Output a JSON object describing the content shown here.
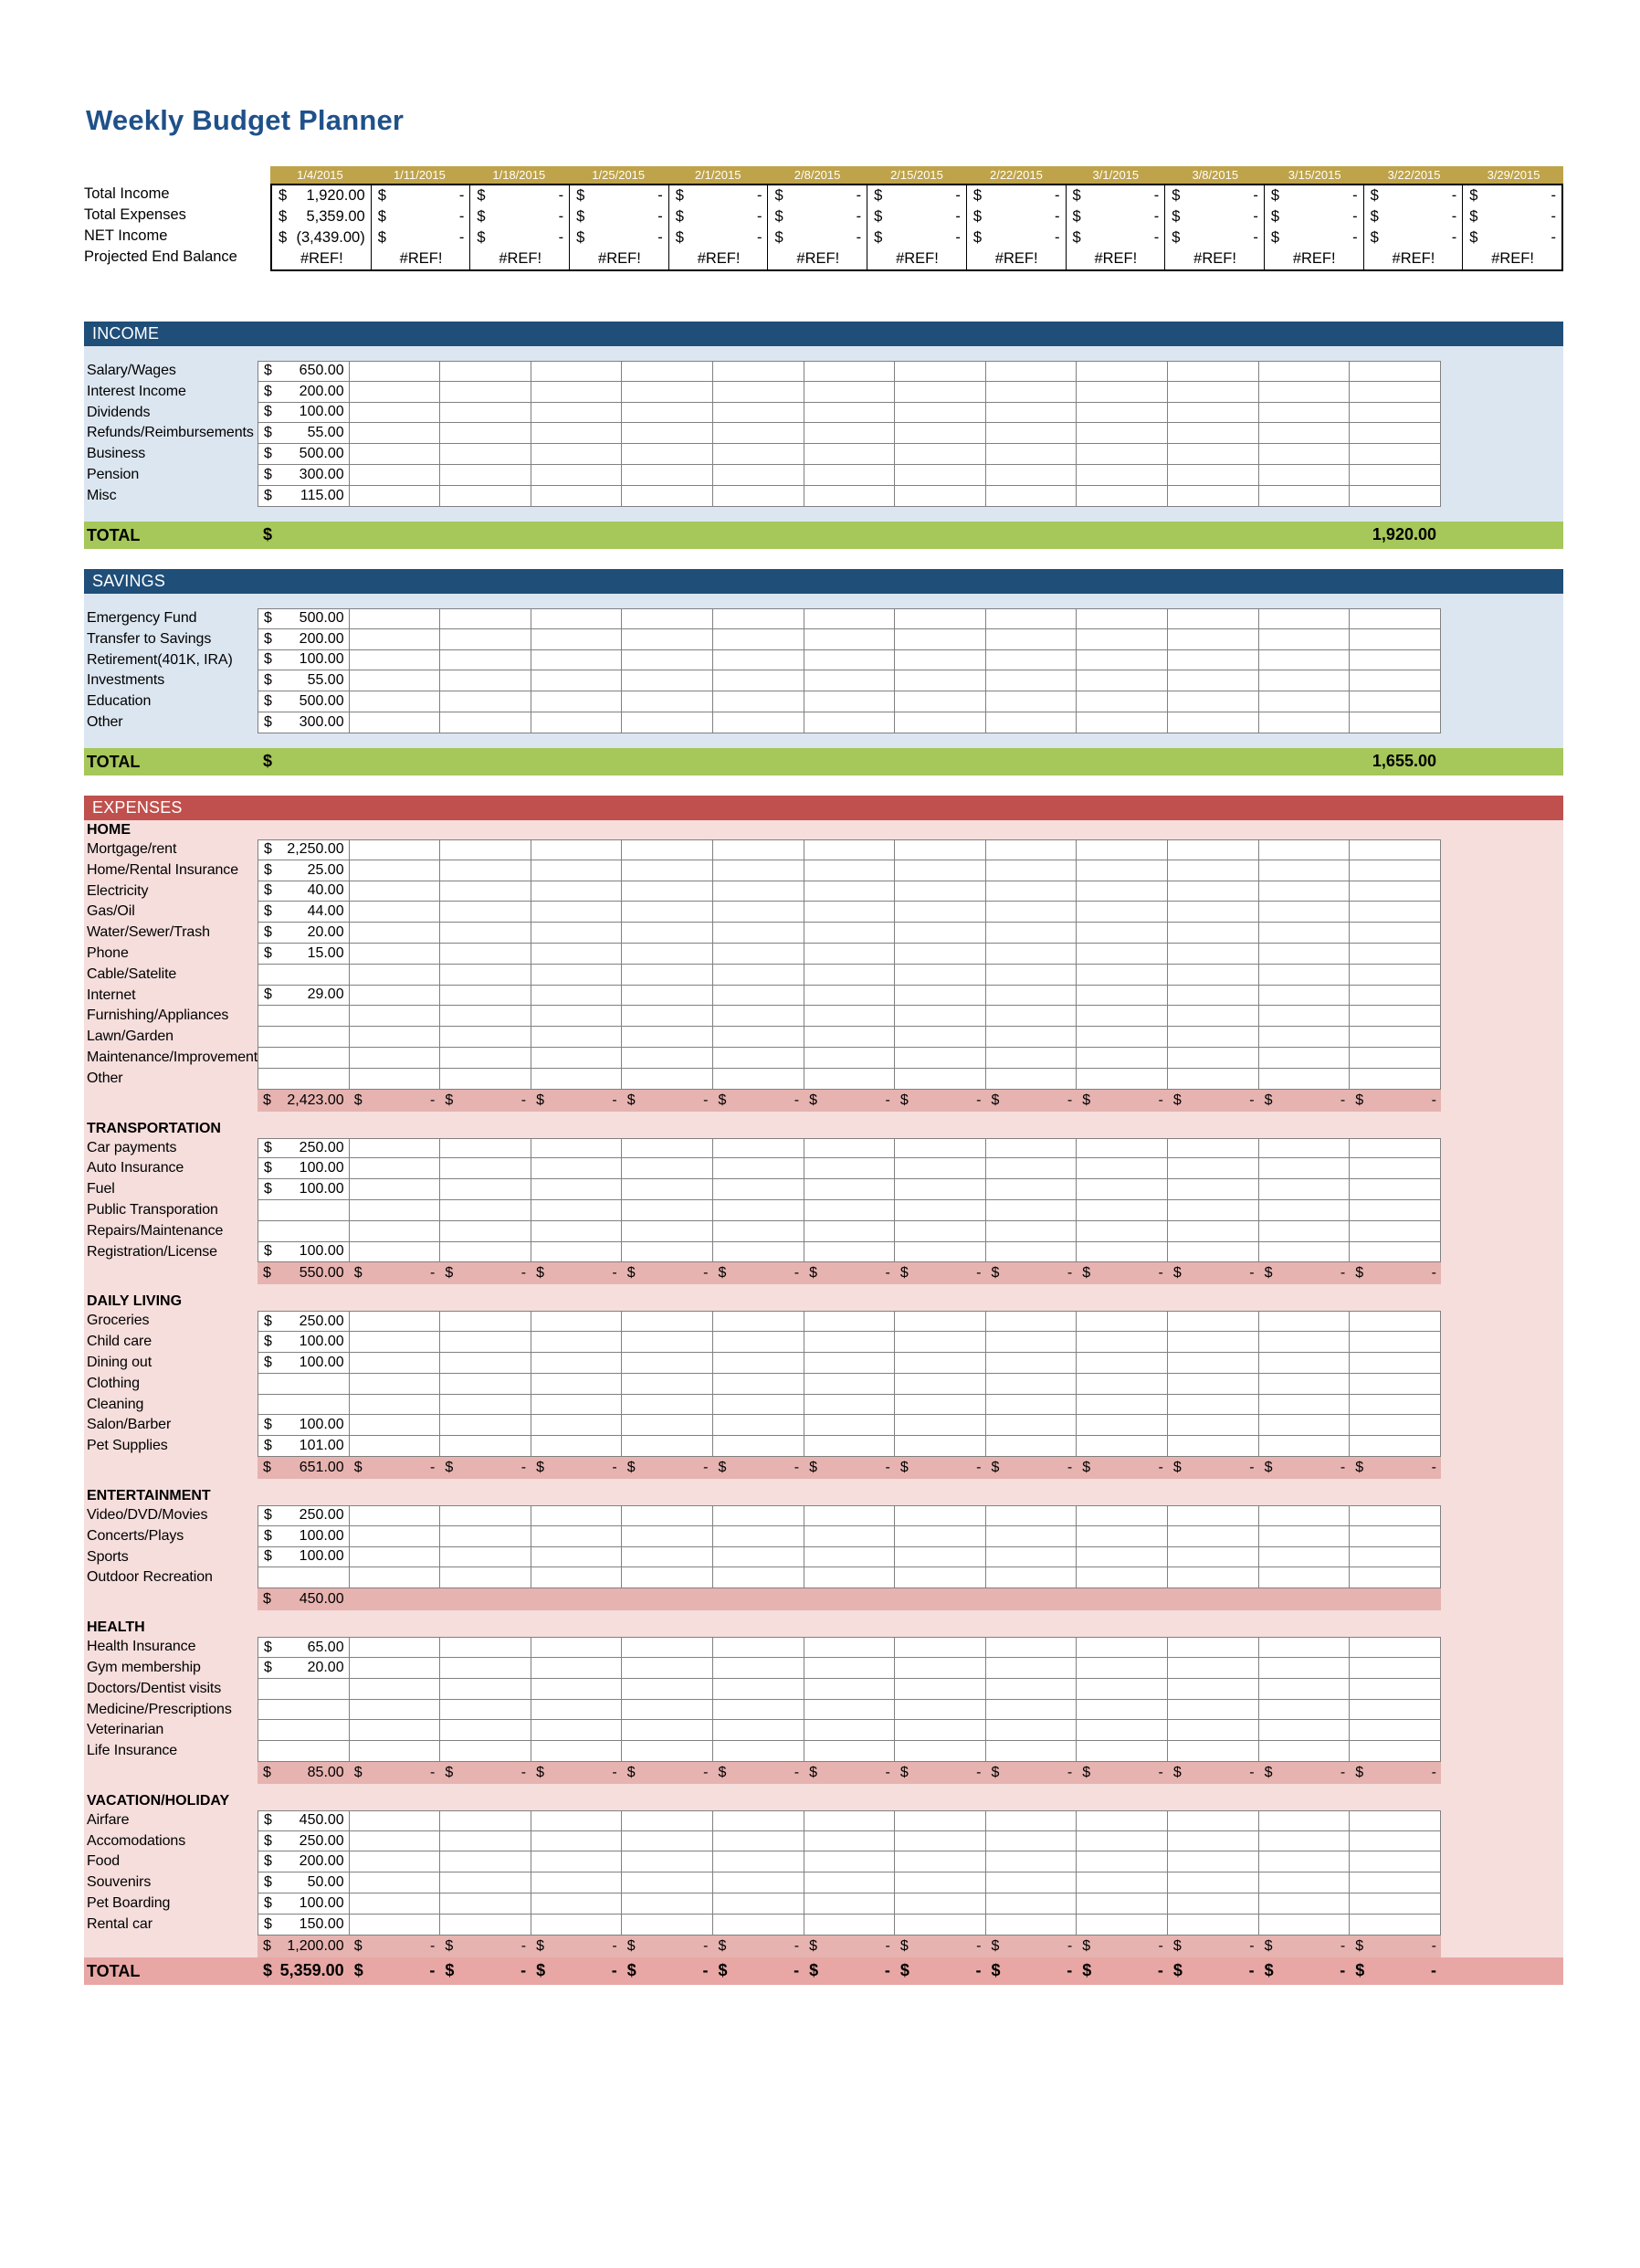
{
  "title": "Weekly Budget Planner",
  "colors": {
    "title": "#1F5189",
    "date_header": "#BFA34A",
    "section_blue": "#1F4E79",
    "section_blue_body": "#DCE6F1",
    "section_red": "#C0504D",
    "section_red_body": "#F5DEDC",
    "total_green": "#A6C75A",
    "total_pink": "#E8A7A4",
    "subtotal_pink": "#E6B3B0"
  },
  "dates": [
    "1/4/2015",
    "1/11/2015",
    "1/18/2015",
    "1/25/2015",
    "2/1/2015",
    "2/8/2015",
    "2/15/2015",
    "2/22/2015",
    "3/1/2015",
    "3/8/2015",
    "3/15/2015",
    "3/22/2015",
    "3/29/2015"
  ],
  "summary": {
    "rows": [
      {
        "label": "Total Income",
        "values": [
          "1,920.00",
          "-",
          "-",
          "-",
          "-",
          "-",
          "-",
          "-",
          "-",
          "-",
          "-",
          "-",
          "-"
        ],
        "currency": "$"
      },
      {
        "label": "Total Expenses",
        "values": [
          "5,359.00",
          "-",
          "-",
          "-",
          "-",
          "-",
          "-",
          "-",
          "-",
          "-",
          "-",
          "-",
          "-"
        ],
        "currency": "$"
      },
      {
        "label": "NET Income",
        "values": [
          "(3,439.00)",
          "-",
          "-",
          "-",
          "-",
          "-",
          "-",
          "-",
          "-",
          "-",
          "-",
          "-",
          "-"
        ],
        "currency": "$"
      }
    ],
    "ref_row": {
      "label": "Projected End Balance",
      "values": [
        "#REF!",
        "#REF!",
        "#REF!",
        "#REF!",
        "#REF!",
        "#REF!",
        "#REF!",
        "#REF!",
        "#REF!",
        "#REF!",
        "#REF!",
        "#REF!",
        "#REF!"
      ]
    }
  },
  "income": {
    "header": "INCOME",
    "items": [
      {
        "label": "Salary/Wages",
        "value": "650.00",
        "currency": "$"
      },
      {
        "label": "Interest Income",
        "value": "200.00",
        "currency": "$"
      },
      {
        "label": "Dividends",
        "value": "100.00",
        "currency": "$"
      },
      {
        "label": "Refunds/Reimbursements",
        "value": "55.00",
        "currency": "$"
      },
      {
        "label": "Business",
        "value": "500.00",
        "currency": "$"
      },
      {
        "label": "Pension",
        "value": "300.00",
        "currency": "$"
      },
      {
        "label": "Misc",
        "value": "115.00",
        "currency": "$"
      }
    ],
    "total": {
      "label": "TOTAL",
      "currency": "$",
      "value": "1,920.00"
    }
  },
  "savings": {
    "header": "SAVINGS",
    "items": [
      {
        "label": "Emergency Fund",
        "value": "500.00",
        "currency": "$"
      },
      {
        "label": "Transfer to Savings",
        "value": "200.00",
        "currency": "$"
      },
      {
        "label": "Retirement(401K, IRA)",
        "value": "100.00",
        "currency": "$"
      },
      {
        "label": "Investments",
        "value": "55.00",
        "currency": "$"
      },
      {
        "label": "Education",
        "value": "500.00",
        "currency": "$"
      },
      {
        "label": "Other",
        "value": "300.00",
        "currency": "$"
      }
    ],
    "total": {
      "label": "TOTAL",
      "currency": "$",
      "value": "1,655.00"
    }
  },
  "expenses": {
    "header": "EXPENSES",
    "groups": [
      {
        "title": "HOME",
        "items": [
          {
            "label": "Mortgage/rent",
            "value": "2,250.00",
            "currency": "$"
          },
          {
            "label": "Home/Rental Insurance",
            "value": "25.00",
            "currency": "$"
          },
          {
            "label": "Electricity",
            "value": "40.00",
            "currency": "$"
          },
          {
            "label": "Gas/Oil",
            "value": "44.00",
            "currency": "$"
          },
          {
            "label": "Water/Sewer/Trash",
            "value": "20.00",
            "currency": "$"
          },
          {
            "label": "Phone",
            "value": "15.00",
            "currency": "$"
          },
          {
            "label": "Cable/Satelite",
            "value": "",
            "currency": ""
          },
          {
            "label": "Internet",
            "value": "29.00",
            "currency": "$"
          },
          {
            "label": "Furnishing/Appliances",
            "value": "",
            "currency": ""
          },
          {
            "label": "Lawn/Garden",
            "value": "",
            "currency": ""
          },
          {
            "label": "Maintenance/Improvements",
            "value": "",
            "currency": ""
          },
          {
            "label": "Other",
            "value": "",
            "currency": ""
          }
        ],
        "subtotal": {
          "currency": "$",
          "value": "2,423.00",
          "dash_count": 12
        }
      },
      {
        "title": "TRANSPORTATION",
        "items": [
          {
            "label": "Car payments",
            "value": "250.00",
            "currency": "$"
          },
          {
            "label": "Auto Insurance",
            "value": "100.00",
            "currency": "$"
          },
          {
            "label": "Fuel",
            "value": "100.00",
            "currency": "$"
          },
          {
            "label": "Public Transporation",
            "value": "",
            "currency": ""
          },
          {
            "label": "Repairs/Maintenance",
            "value": "",
            "currency": ""
          },
          {
            "label": "Registration/License",
            "value": "100.00",
            "currency": "$"
          }
        ],
        "subtotal": {
          "currency": "$",
          "value": "550.00",
          "dash_count": 12
        }
      },
      {
        "title": "DAILY LIVING",
        "items": [
          {
            "label": "Groceries",
            "value": "250.00",
            "currency": "$"
          },
          {
            "label": "Child care",
            "value": "100.00",
            "currency": "$"
          },
          {
            "label": "Dining out",
            "value": "100.00",
            "currency": "$"
          },
          {
            "label": "Clothing",
            "value": "",
            "currency": ""
          },
          {
            "label": "Cleaning",
            "value": "",
            "currency": ""
          },
          {
            "label": "Salon/Barber",
            "value": "100.00",
            "currency": "$"
          },
          {
            "label": "Pet Supplies",
            "value": "101.00",
            "currency": "$"
          }
        ],
        "subtotal": {
          "currency": "$",
          "value": "651.00",
          "dash_count": 12
        }
      },
      {
        "title": "ENTERTAINMENT",
        "items": [
          {
            "label": "Video/DVD/Movies",
            "value": "250.00",
            "currency": "$"
          },
          {
            "label": "Concerts/Plays",
            "value": "100.00",
            "currency": "$"
          },
          {
            "label": "Sports",
            "value": "100.00",
            "currency": "$"
          },
          {
            "label": "Outdoor Recreation",
            "value": "",
            "currency": ""
          }
        ],
        "subtotal": {
          "currency": "$",
          "value": "450.00",
          "dash_count": 0
        }
      },
      {
        "title": "HEALTH",
        "items": [
          {
            "label": "Health Insurance",
            "value": "65.00",
            "currency": "$"
          },
          {
            "label": "Gym membership",
            "value": "20.00",
            "currency": "$"
          },
          {
            "label": "Doctors/Dentist visits",
            "value": "",
            "currency": ""
          },
          {
            "label": "Medicine/Prescriptions",
            "value": "",
            "currency": ""
          },
          {
            "label": "Veterinarian",
            "value": "",
            "currency": ""
          },
          {
            "label": "Life Insurance",
            "value": "",
            "currency": ""
          }
        ],
        "subtotal": {
          "currency": "$",
          "value": "85.00",
          "dash_count": 12
        }
      },
      {
        "title": "VACATION/HOLIDAY",
        "items": [
          {
            "label": "Airfare",
            "value": "450.00",
            "currency": "$"
          },
          {
            "label": "Accomodations",
            "value": "250.00",
            "currency": "$"
          },
          {
            "label": "Food",
            "value": "200.00",
            "currency": "$"
          },
          {
            "label": "Souvenirs",
            "value": "50.00",
            "currency": "$"
          },
          {
            "label": "Pet Boarding",
            "value": "100.00",
            "currency": "$"
          },
          {
            "label": "Rental car",
            "value": "150.00",
            "currency": "$"
          }
        ],
        "subtotal": {
          "currency": "$",
          "value": "1,200.00",
          "dash_count": 12
        }
      }
    ],
    "total": {
      "label": "TOTAL",
      "currency": "$",
      "value": "5,359.00",
      "dash_count": 12
    }
  }
}
